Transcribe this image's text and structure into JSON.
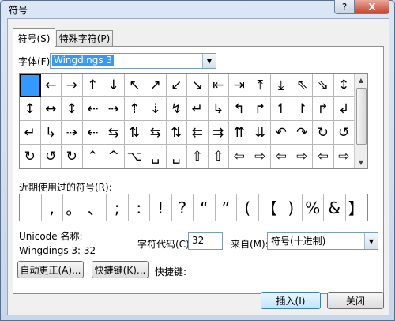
{
  "window": {
    "title": "符号",
    "help": "?",
    "close": "X"
  },
  "tabs": [
    {
      "label": "符号(S)"
    },
    {
      "label": "特殊字符(P)"
    }
  ],
  "font": {
    "label": "字体(F):",
    "value": "Wingdings 3"
  },
  "symbol_rows": [
    [
      "",
      "←",
      "→",
      "↑",
      "↓",
      "↖",
      "↗",
      "↙",
      "↘",
      "⇤",
      "⇥",
      "⤒",
      "⤓",
      "⇖",
      "⇘",
      "↕"
    ],
    [
      "↕",
      "↔",
      "↕",
      "⇠",
      "⇢",
      "⇡",
      "⇣",
      "↯",
      "↵",
      "↳",
      "↰",
      "↱",
      "↿",
      "↾",
      "↱",
      "↲"
    ],
    [
      "↵",
      "↳",
      "⇢",
      "⇠",
      "⇆",
      "⇅",
      "⇆",
      "⇅",
      "⇇",
      "⇉",
      "⇈",
      "⇊",
      "↶",
      "↷",
      "↻",
      "↺"
    ],
    [
      "↻",
      "↺",
      "↻",
      "⌃",
      "^",
      "⌥",
      "␣",
      "␣",
      "⇧",
      "⇧",
      "⇦",
      "⇨",
      "⇦",
      "⇨",
      "⇦",
      "⇨"
    ]
  ],
  "recent": {
    "label": "近期使用过的符号(R):",
    "items": [
      "",
      ",",
      "。",
      "、",
      ";",
      ":",
      "!",
      "?",
      "“",
      "”",
      "(",
      "【",
      ")",
      "%",
      "&",
      "】"
    ]
  },
  "unicode": {
    "name_label": "Unicode 名称:",
    "name_value": "Wingdings 3: 32"
  },
  "char_code": {
    "label": "字符代码(C):",
    "value": "32"
  },
  "from": {
    "label": "来自(M):",
    "value": "符号(十进制)"
  },
  "buttons": {
    "autocorrect": "自动更正(A)...",
    "shortcut": "快捷键(K)...",
    "shortcut_label": "快捷键:",
    "insert": "插入(I)",
    "close": "关闭"
  }
}
